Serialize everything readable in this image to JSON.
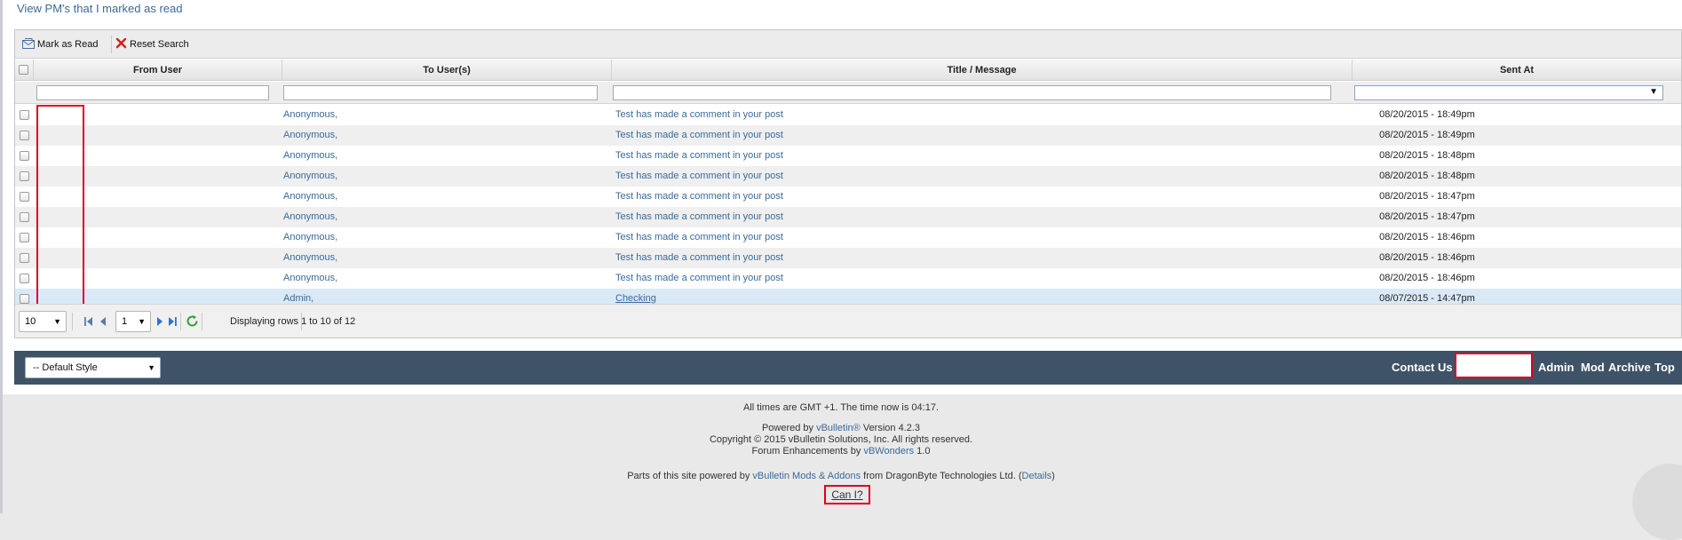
{
  "top_link": "View PM's that I marked as read",
  "toolbar": {
    "mark_read": "Mark as Read",
    "reset_search": "Reset Search"
  },
  "columns": {
    "from": "From User",
    "to": "To User(s)",
    "title": "Title / Message",
    "sent": "Sent At"
  },
  "rows": [
    {
      "to": "Anonymous,",
      "title": "Test has made a comment in your post",
      "sent": "08/20/2015 - 18:49pm"
    },
    {
      "to": "Anonymous,",
      "title": "Test has made a comment in your post",
      "sent": "08/20/2015 - 18:49pm"
    },
    {
      "to": "Anonymous,",
      "title": "Test has made a comment in your post",
      "sent": "08/20/2015 - 18:48pm"
    },
    {
      "to": "Anonymous,",
      "title": "Test has made a comment in your post",
      "sent": "08/20/2015 - 18:48pm"
    },
    {
      "to": "Anonymous,",
      "title": "Test has made a comment in your post",
      "sent": "08/20/2015 - 18:47pm"
    },
    {
      "to": "Anonymous,",
      "title": "Test has made a comment in your post",
      "sent": "08/20/2015 - 18:47pm"
    },
    {
      "to": "Anonymous,",
      "title": "Test has made a comment in your post",
      "sent": "08/20/2015 - 18:46pm"
    },
    {
      "to": "Anonymous,",
      "title": "Test has made a comment in your post",
      "sent": "08/20/2015 - 18:46pm"
    },
    {
      "to": "Anonymous,",
      "title": "Test has made a comment in your post",
      "sent": "08/20/2015 - 18:46pm"
    },
    {
      "to": "Admin,",
      "title": "Checking",
      "sent": "08/07/2015 - 14:47pm",
      "selected": true
    }
  ],
  "pager": {
    "page_size": "10",
    "page": "1",
    "info": "Displaying rows 1 to 10 of 12"
  },
  "footer": {
    "style_select": "-- Default Style",
    "links": [
      "Contact Us",
      "Admin",
      "Mod",
      "Archive",
      "Top"
    ]
  },
  "legal": {
    "times": "All times are GMT +1. The time now is 04:17.",
    "powered_pre": "Powered by ",
    "powered_link": "vBulletin®",
    "powered_post": " Version 4.2.3",
    "copyright": "Copyright © 2015 vBulletin Solutions, Inc. All rights reserved.",
    "enh_pre": "Forum Enhancements by ",
    "enh_link": "vBWonders",
    "enh_post": " 1.0",
    "parts_pre": "Parts of this site powered by ",
    "parts_link": "vBulletin Mods & Addons",
    "parts_mid": " from DragonByte Technologies Ltd. (",
    "parts_details": "Details",
    "parts_end": ")",
    "can_i": "Can I?"
  },
  "colors": {
    "link": "#3b6a98",
    "footer_bar": "#3e5367",
    "highlight": "#e0001b",
    "selected_row": "#d9e9f5"
  }
}
